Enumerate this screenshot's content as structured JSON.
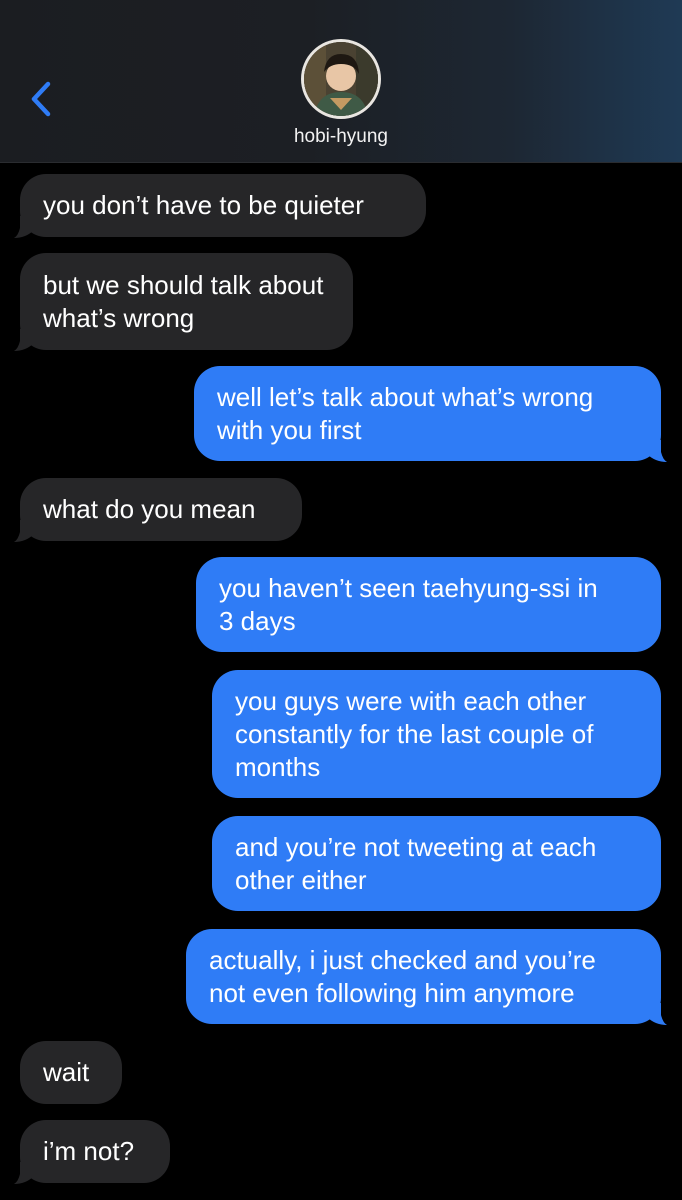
{
  "header": {
    "contact_name": "hobi-hyung",
    "back_icon": "chevron-left-icon",
    "accent_color": "#2f7cf6"
  },
  "messages": [
    {
      "direction": "in",
      "text": "you don’t have to be quieter"
    },
    {
      "direction": "in",
      "text": "but we should talk about\nwhat’s wrong"
    },
    {
      "direction": "out",
      "text": "well let’s talk about what’s wrong\nwith you first"
    },
    {
      "direction": "in",
      "text": "what do you mean"
    },
    {
      "direction": "out",
      "text": "you haven’t seen taehyung-ssi in\n3 days"
    },
    {
      "direction": "out",
      "text": "you guys were with each other\nconstantly for the last couple of\nmonths"
    },
    {
      "direction": "out",
      "text": "and you’re not tweeting at each\nother either"
    },
    {
      "direction": "out",
      "text": "actually, i just checked and you’re\nnot even following him anymore"
    },
    {
      "direction": "in",
      "text": "wait"
    },
    {
      "direction": "in",
      "text": "i’m not?"
    }
  ],
  "colors": {
    "incoming_bubble": "#262628",
    "outgoing_bubble": "#2f7cf6",
    "background": "#000000"
  }
}
